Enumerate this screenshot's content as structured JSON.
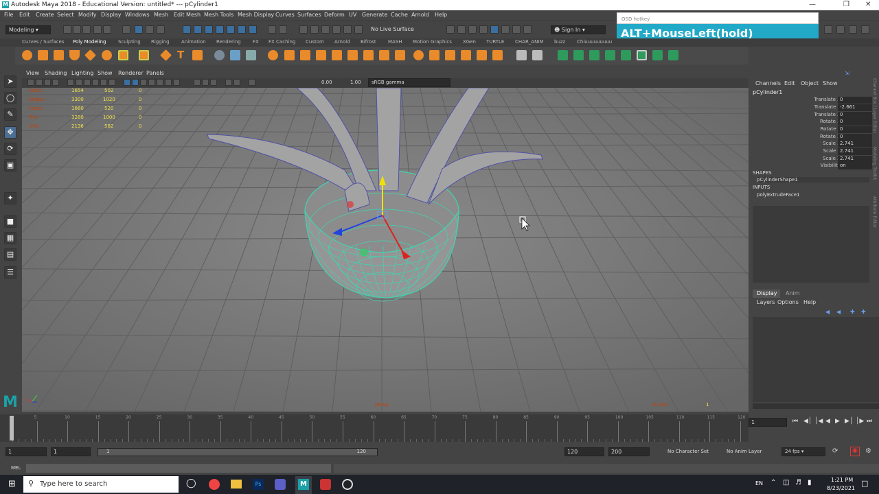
{
  "window": {
    "title": "Autodesk Maya 2018 - Educational Version: untitled*   ---   pCylinder1",
    "logo": "M"
  },
  "menu": [
    "File",
    "Edit",
    "Create",
    "Select",
    "Modify",
    "Display",
    "Windows",
    "Mesh",
    "Edit Mesh",
    "Mesh Tools",
    "Mesh Display",
    "Curves",
    "Surfaces",
    "Deform",
    "UV",
    "Generate",
    "Cache",
    "Arnold",
    "Help"
  ],
  "status": {
    "mode": "Modeling",
    "live_surface": "No Live Surface",
    "sign_in": "Sign In"
  },
  "shelf_tabs": [
    "Curves / Surfaces",
    "Poly Modeling",
    "Sculpting",
    "Rigging",
    "Animation",
    "Rendering",
    "FX",
    "FX Caching",
    "Custom",
    "Arnold",
    "Bifrost",
    "MASH",
    "Motion Graphics",
    "XGen",
    "TURTLE",
    "CHAR_ANIM",
    "buzz",
    "Chiuuuuuuuuu"
  ],
  "active_shelf_tab": "Poly Modeling",
  "panel_menu": [
    "View",
    "Shading",
    "Lighting",
    "Show",
    "Renderer",
    "Panels"
  ],
  "vp_toolbar": {
    "exposure": "0.00",
    "gamma": "1.00",
    "color_space": "sRGB gamma"
  },
  "hud": {
    "rows": [
      {
        "label": "Verts:",
        "a": "1654",
        "b": "502",
        "c": "0"
      },
      {
        "label": "Edges:",
        "a": "3300",
        "b": "1020",
        "c": "0"
      },
      {
        "label": "Faces:",
        "a": "1660",
        "b": "520",
        "c": "0"
      },
      {
        "label": "Tris:",
        "a": "3280",
        "b": "1000",
        "c": "0"
      },
      {
        "label": "UVs:",
        "a": "2136",
        "b": "582",
        "c": "0"
      }
    ],
    "camera": "persp",
    "frame_label": "Frame:",
    "frame_value": "1"
  },
  "osd": {
    "title": "OSD hotkey",
    "hotkey": "ALT+MouseLeft(hold)"
  },
  "channel_box": {
    "menu": [
      "Channels",
      "Edit",
      "Object",
      "Show"
    ],
    "object": "pCylinder1",
    "attributes": [
      {
        "name": "Translate X",
        "value": "0"
      },
      {
        "name": "Translate Y",
        "value": "-2.661"
      },
      {
        "name": "Translate Z",
        "value": "0"
      },
      {
        "name": "Rotate X",
        "value": "0"
      },
      {
        "name": "Rotate Y",
        "value": "0"
      },
      {
        "name": "Rotate Z",
        "value": "0"
      },
      {
        "name": "Scale X",
        "value": "2.741"
      },
      {
        "name": "Scale Y",
        "value": "2.741"
      },
      {
        "name": "Scale Z",
        "value": "2.741"
      },
      {
        "name": "Visibility",
        "value": "on"
      }
    ],
    "shapes_header": "SHAPES",
    "shape": "pCylinderShape1",
    "inputs_header": "INPUTS",
    "input": "polyExtrudeFace1",
    "side_tabs": [
      "Channel Box / Layer Editor",
      "Modeling Toolkit",
      "Attribute Editor"
    ]
  },
  "layer_editor": {
    "tabs": [
      "Display",
      "Anim"
    ],
    "menu": [
      "Layers",
      "Options",
      "Help"
    ]
  },
  "timeline": {
    "ticks": [
      "5",
      "10",
      "15",
      "20",
      "25",
      "30",
      "35",
      "40",
      "45",
      "50",
      "55",
      "60",
      "65",
      "70",
      "75",
      "80",
      "85",
      "90",
      "95",
      "100",
      "105",
      "110",
      "115",
      "120"
    ],
    "current_frame": "1"
  },
  "range": {
    "start": "1",
    "inner_start": "1",
    "slider_start": "1",
    "slider_end": "120",
    "end": "120",
    "anim_end": "200",
    "char_set": "No Character Set",
    "anim_layer": "No Anim Layer",
    "fps": "24 fps"
  },
  "cmdline": {
    "lang": "MEL"
  },
  "taskbar": {
    "search_placeholder": "Type here to search",
    "lang": "EN",
    "time": "1:21 PM",
    "date": "8/23/2021"
  }
}
